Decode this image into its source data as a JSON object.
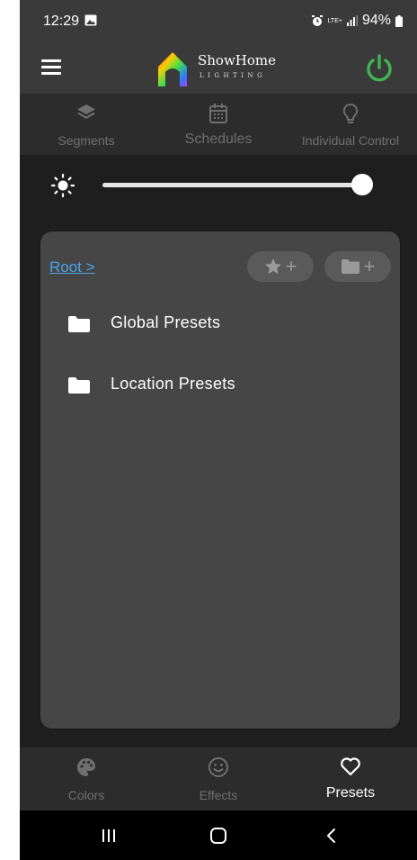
{
  "status_bar": {
    "time": "12:29",
    "network": "LTE+",
    "battery": "94%",
    "icons": [
      "image-icon",
      "alarm-icon",
      "signal-icon",
      "battery-icon"
    ]
  },
  "header": {
    "app_name": "ShowHome",
    "app_subtitle": "LIGHTING",
    "power_color": "#3fb34f"
  },
  "top_tabs": [
    {
      "label": "Segments",
      "icon": "layers-icon"
    },
    {
      "label": "Schedules",
      "icon": "calendar-icon"
    },
    {
      "label": "Individual Control",
      "icon": "bulb-icon"
    }
  ],
  "brightness": {
    "icon": "brightness-icon",
    "level": 1.0
  },
  "presets_panel": {
    "breadcrumb": "Root >",
    "add_favorite_icon": "star-plus-icon",
    "add_folder_icon": "folder-plus-icon",
    "folders": [
      {
        "label": "Global Presets",
        "icon": "folder-icon"
      },
      {
        "label": "Location Presets",
        "icon": "folder-icon"
      }
    ]
  },
  "bottom_nav": [
    {
      "label": "Colors",
      "icon": "palette-icon",
      "active": false
    },
    {
      "label": "Effects",
      "icon": "smiley-icon",
      "active": false
    },
    {
      "label": "Presets",
      "icon": "heart-icon",
      "active": true
    }
  ],
  "colors": {
    "link": "#4aa3e8",
    "inactive": "#6f6f6f",
    "active": "#ffffff"
  }
}
